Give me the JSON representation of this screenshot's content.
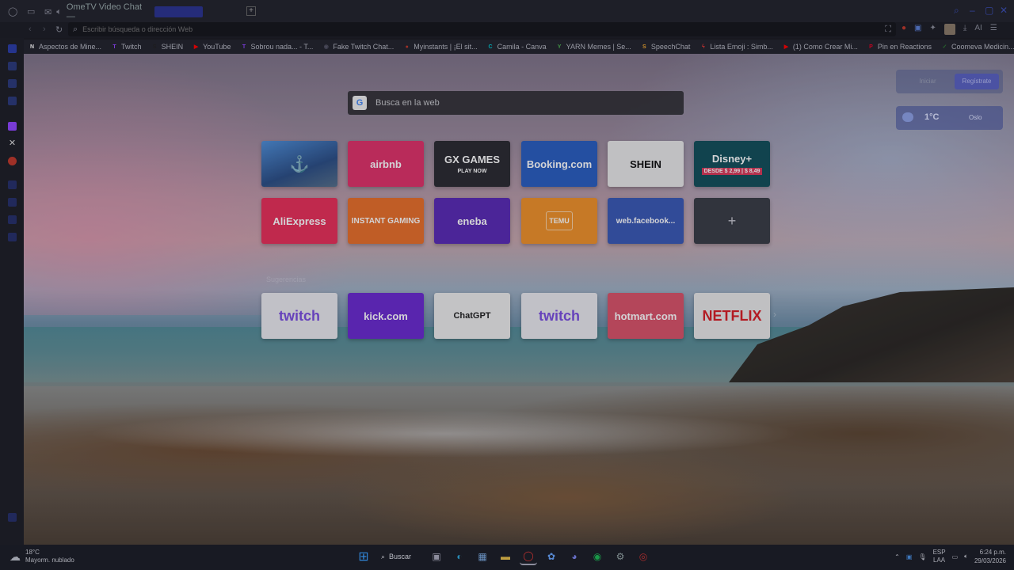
{
  "browser": {
    "tab_title": "OmeTV Video Chat — ",
    "address_placeholder": "Escribir búsqueda o dirección Web",
    "new_tab": "+",
    "ai_label": "AI"
  },
  "bookmarks": [
    {
      "label": "Aspectos de Mine...",
      "icon": "N",
      "color": "#ffffff"
    },
    {
      "label": "Twitch",
      "icon": "T",
      "color": "#9146ff"
    },
    {
      "label": "SHEIN",
      "icon": "S",
      "color": "#222222"
    },
    {
      "label": "YouTube",
      "icon": "▶",
      "color": "#ff0000"
    },
    {
      "label": "Sobrou nada... - T...",
      "icon": "T",
      "color": "#9146ff"
    },
    {
      "label": "Fake Twitch Chat...",
      "icon": "◉",
      "color": "#556"
    },
    {
      "label": "Myinstants | ¡El sit...",
      "icon": "●",
      "color": "#c0392b"
    },
    {
      "label": "Camila - Canva",
      "icon": "C",
      "color": "#00c4cc"
    },
    {
      "label": "YARN Memes | Se...",
      "icon": "Y",
      "color": "#4caf50"
    },
    {
      "label": "SpeechChat",
      "icon": "S",
      "color": "#f0a830"
    },
    {
      "label": "Lista Emoji : Simb...",
      "icon": "ϟ",
      "color": "#e53935"
    },
    {
      "label": "(1) Como Crear Mi...",
      "icon": "▶",
      "color": "#ff0000"
    },
    {
      "label": "Pin en Reactions",
      "icon": "P",
      "color": "#e60023"
    },
    {
      "label": "Coomeva Medicin...",
      "icon": "✓",
      "color": "#2e7d32"
    }
  ],
  "search": {
    "placeholder": "Busca en la web",
    "engine_icon": "G"
  },
  "account": {
    "login": "Iniciar",
    "register": "Regístrate"
  },
  "weather": {
    "temp": "1°C",
    "city": "Oslo"
  },
  "speed_dial": [
    {
      "label": "",
      "kind": "ship",
      "bg": "#3b6fb5",
      "fg": "#ffffff"
    },
    {
      "label": "airbnb",
      "kind": "text",
      "bg": "#e0326a",
      "fg": "#ffffff"
    },
    {
      "label": "GX GAMES",
      "sub": "PLAY NOW",
      "kind": "gx",
      "bg": "#2b2b31",
      "fg": "#ffffff"
    },
    {
      "label": "Booking.com",
      "kind": "text",
      "bg": "#2a5fc0",
      "fg": "#ffffff"
    },
    {
      "label": "SHEIN",
      "kind": "text",
      "bg": "#e8e8e8",
      "fg": "#111111"
    },
    {
      "label": "Disney+",
      "sub": "DESDE  $ 2,99 | $ 8,49",
      "kind": "disney",
      "bg": "#13505b",
      "fg": "#ffffff"
    },
    {
      "label": "AliExpress",
      "kind": "text",
      "bg": "#e8305a",
      "fg": "#ffffff"
    },
    {
      "label": "INSTANT GAMING",
      "kind": "text",
      "bg": "#e8702a",
      "fg": "#ffffff"
    },
    {
      "label": "eneba",
      "kind": "text",
      "bg": "#5a2bb5",
      "fg": "#ffffff"
    },
    {
      "label": "TEMU",
      "kind": "temu",
      "bg": "#f0922a",
      "fg": "#ffffff"
    },
    {
      "label": "web.facebook...",
      "kind": "text",
      "bg": "#3a59b5",
      "fg": "#ffffff"
    },
    {
      "label": "+",
      "kind": "add",
      "bg": "#3a3d46",
      "fg": "#c8c8d0"
    }
  ],
  "suggestions_label": "Sugerencias",
  "suggestions": [
    {
      "label": "twitch",
      "bg": "#e9e9ee",
      "fg": "#7b4fe0"
    },
    {
      "label": "kick.com",
      "bg": "#6b2bd0",
      "fg": "#ffffff"
    },
    {
      "label": "ChatGPT",
      "bg": "#ececec",
      "fg": "#222222"
    },
    {
      "label": "twitch",
      "bg": "#e9e9ee",
      "fg": "#7b4fe0"
    },
    {
      "label": "hotmart.com",
      "bg": "#d9536a",
      "fg": "#ffffff"
    },
    {
      "label": "NETFLIX",
      "bg": "#e8e8e8",
      "fg": "#d81f26"
    }
  ],
  "taskbar": {
    "weather_temp": "18°C",
    "weather_desc": "Mayorm. nublado",
    "search": "Buscar",
    "lang_1": "ESP",
    "lang_2": "LAA",
    "time": "6:24 p.m.",
    "date": "29/03/2026"
  }
}
